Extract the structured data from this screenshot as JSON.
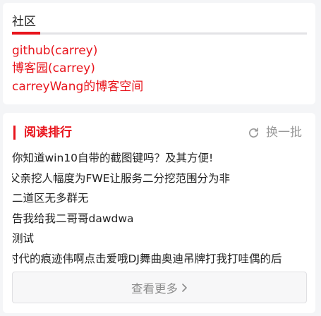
{
  "community": {
    "title": "社区",
    "links": [
      {
        "label": "github(carrey)"
      },
      {
        "label": "博客园(carrey)"
      },
      {
        "label": "carreyWang的博客空间"
      }
    ]
  },
  "ranking": {
    "title": "阅读排行",
    "refresh_label": "换一批",
    "items": [
      {
        "title": "你知道win10自带的截图键吗？及其方便!"
      },
      {
        "title": "父亲挖人幅度为FWE让服务二分挖范围分为非"
      },
      {
        "title": "二道区无多群无"
      },
      {
        "title": "告我给我二哥哥dawdwa"
      },
      {
        "title": "测试"
      },
      {
        "title": "时代的痕迹伟啊点击爱哦DJ舞曲奥迪吊牌打我打哇偶的后"
      }
    ],
    "more_label": "查看更多"
  },
  "colors": {
    "accent": "#e8141c",
    "text": "#222222",
    "muted": "#9a9a9a",
    "background": "#f4f5f7"
  }
}
